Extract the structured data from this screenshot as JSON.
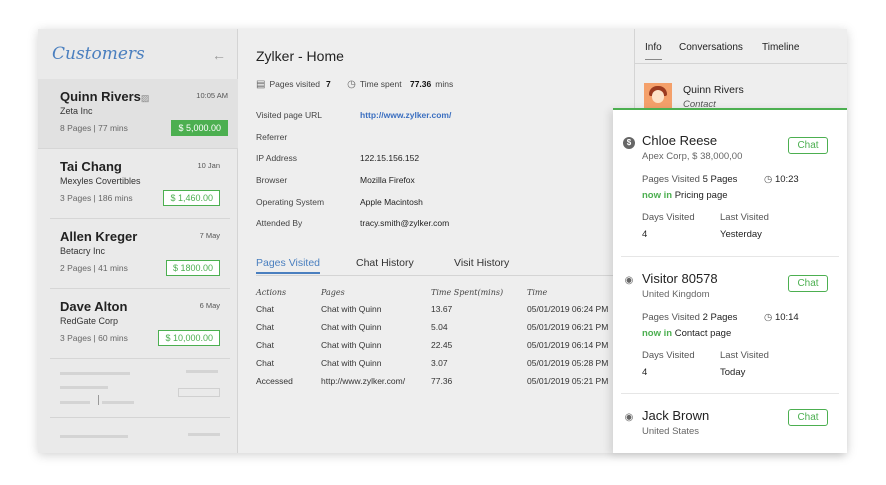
{
  "sidebar": {
    "title": "Customers",
    "back_icon": "arrow-left-icon",
    "customers": [
      {
        "name": "Quinn Rivers",
        "time": "10:05 AM",
        "org": "Zeta Inc",
        "meta": "8 Pages | 77 mins",
        "amount": "$ 5,000.00"
      },
      {
        "name": "Tai Chang",
        "time": "10 Jan",
        "org": "Mexyles Covertibles",
        "meta": "3 Pages | 186 mins",
        "amount": "$ 1,460.00"
      },
      {
        "name": "Allen Kreger",
        "time": "7 May",
        "org": "Betacry Inc",
        "meta": "2 Pages | 41 mins",
        "amount": "$ 1800.00"
      },
      {
        "name": "Dave Alton",
        "time": "6 May",
        "org": "RedGate Corp",
        "meta": "3 Pages | 60 mins",
        "amount": "$ 10,000.00"
      }
    ]
  },
  "main": {
    "title": "Zylker - Home",
    "pages_visited_label": "Pages visited",
    "pages_visited_value": "7",
    "time_spent_label": "Time spent",
    "time_spent_value": "77.36",
    "time_spent_unit": "mins",
    "details": [
      {
        "label": "Visited page URL",
        "value": "http://www.zylker.com/"
      },
      {
        "label": "Referrer",
        "value": ""
      },
      {
        "label": "IP Address",
        "value": "122.15.156.152"
      },
      {
        "label": "Browser",
        "value": "Mozilla Firefox"
      },
      {
        "label": "Operating System",
        "value": "Apple Macintosh"
      },
      {
        "label": "Attended By",
        "value": "tracy.smith@zylker.com"
      }
    ],
    "tabs": [
      "Pages Visited",
      "Chat History",
      "Visit History"
    ],
    "table": {
      "headers": [
        "Actions",
        "Pages",
        "Time Spent(mins)",
        "Time"
      ],
      "rows": [
        [
          "Chat",
          "Chat with Quinn",
          "13.67",
          "05/01/2019 06:24 PM"
        ],
        [
          "Chat",
          "Chat with Quinn",
          "5.04",
          "05/01/2019 06:21 PM"
        ],
        [
          "Chat",
          "Chat with Quinn",
          "22.45",
          "05/01/2019 06:14 PM"
        ],
        [
          "Chat",
          "Chat with Quinn",
          "3.07",
          "05/01/2019 05:28 PM"
        ],
        [
          "Accessed",
          "http://www.zylker.com/",
          "77.36",
          "05/01/2019 05:21 PM"
        ]
      ]
    }
  },
  "info": {
    "tabs": [
      "Info",
      "Conversations",
      "Timeline"
    ],
    "contact_name": "Quinn Rivers",
    "contact_role": "Contact"
  },
  "visitors": [
    {
      "name": "Chloe Reese",
      "sub": "Apex Corp, $ 38,000,00",
      "chat": "Chat",
      "icon": "dollar-icon",
      "pages_label": "Pages Visited",
      "pages_value": "5 Pages",
      "time": "10:23",
      "now_label": "now in",
      "now_page": "Pricing page",
      "days_label": "Days Visited",
      "days_value": "4",
      "last_label": "Last Visited",
      "last_value": "Yesterday"
    },
    {
      "name": "Visitor 80578",
      "sub": "United Kingdom",
      "chat": "Chat",
      "icon": "eye-icon",
      "pages_label": "Pages Visited",
      "pages_value": "2 Pages",
      "time": "10:14",
      "now_label": "now in",
      "now_page": "Contact page",
      "days_label": "Days Visited",
      "days_value": "4",
      "last_label": "Last Visited",
      "last_value": "Today"
    },
    {
      "name": "Jack Brown",
      "sub": "United States",
      "chat": "Chat",
      "icon": "eye-icon"
    }
  ]
}
